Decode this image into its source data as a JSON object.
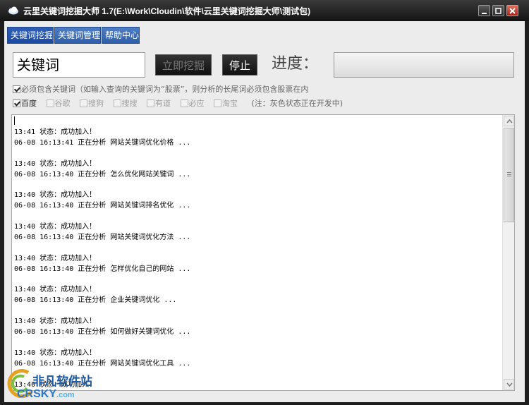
{
  "window": {
    "title": "云里关键词挖掘大师  1.7(E:\\Work\\Cloudin\\软件\\云里关键词挖掘大师\\测试包)",
    "icon": "cloud-icon"
  },
  "tabs": [
    {
      "label": "关键词挖掘",
      "active": true
    },
    {
      "label": "关键词管理",
      "active": false
    },
    {
      "label": "帮助中心",
      "active": false
    }
  ],
  "toolbar": {
    "keyword_value": "关键词",
    "dig_label": "立即挖掘",
    "stop_label": "停止",
    "progress_label": "进度：",
    "progress": 0
  },
  "options": {
    "must_include_label": "必须包含关键词（如输入查询的关键词为“股票”，则分析的长尾词必须包含股票在内",
    "engines": [
      {
        "label": "百度",
        "checked": true,
        "enabled": true
      },
      {
        "label": "谷歌",
        "checked": false,
        "enabled": false
      },
      {
        "label": "搜狗",
        "checked": false,
        "enabled": false
      },
      {
        "label": "搜搜",
        "checked": false,
        "enabled": false
      },
      {
        "label": "有道",
        "checked": false,
        "enabled": false
      },
      {
        "label": "必应",
        "checked": false,
        "enabled": false
      },
      {
        "label": "淘宝",
        "checked": false,
        "enabled": false
      }
    ],
    "note": "(注：灰色状态正在开发中)"
  },
  "log": [
    "13:41 状态：成功加入！",
    "06-08 16:13:41 正在分析 网站关键词优化价格 ...",
    "",
    "13:40 状态：成功加入！",
    "06-08 16:13:40 正在分析 怎么优化网站关键词 ...",
    "",
    "13:40 状态：成功加入！",
    "06-08 16:13:40 正在分析 网站关键词排名优化 ...",
    "",
    "13:40 状态：成功加入！",
    "06-08 16:13:40 正在分析 网站关键词优化方法 ...",
    "",
    "13:40 状态：成功加入！",
    "06-08 16:13:40 正在分析 怎样优化自己的网站 ...",
    "",
    "13:40 状态：成功加入！",
    "06-08 16:13:40 正在分析 企业关键词优化 ...",
    "",
    "13:40 状态：成功加入！",
    "06-08 16:13:40 正在分析 如何做好关键词优化 ...",
    "",
    "13:40 状态：成功加入！",
    "06-08 16:13:40 正在分析 网站关键词优化工具 ...",
    "",
    "13:40 状态：成功加入！"
  ],
  "watermark": {
    "text": "非凡软件站",
    "url": "CRSKY",
    "url_suffix": ".com"
  }
}
